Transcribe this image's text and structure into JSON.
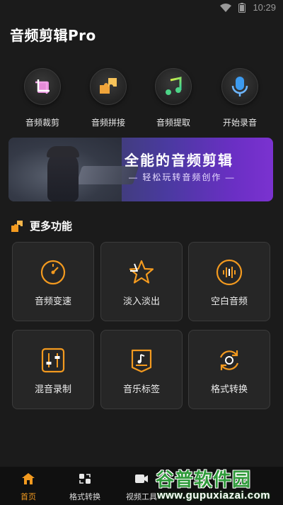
{
  "status": {
    "time": "10:29"
  },
  "app": {
    "title": "音频剪辑Pro"
  },
  "top_tools": [
    {
      "label": "音频裁剪",
      "icon": "crop-icon"
    },
    {
      "label": "音频拼接",
      "icon": "puzzle-icon"
    },
    {
      "label": "音频提取",
      "icon": "music-note-icon"
    },
    {
      "label": "开始录音",
      "icon": "microphone-icon"
    }
  ],
  "banner": {
    "title": "全能的音频剪辑",
    "subtitle": "— 轻松玩转音频创作 —"
  },
  "section": {
    "title": "更多功能"
  },
  "features": [
    {
      "label": "音频变速",
      "icon": "speedometer-icon"
    },
    {
      "label": "淡入淡出",
      "icon": "star-icon"
    },
    {
      "label": "空白音频",
      "icon": "waveform-icon"
    },
    {
      "label": "混音录制",
      "icon": "mixer-sliders-icon"
    },
    {
      "label": "音乐标签",
      "icon": "music-tag-icon"
    },
    {
      "label": "格式转换",
      "icon": "refresh-circle-icon"
    }
  ],
  "nav": [
    {
      "label": "首页",
      "active": true
    },
    {
      "label": "格式转换",
      "active": false
    },
    {
      "label": "视频工具",
      "active": false
    }
  ],
  "watermark": {
    "name": "谷普软件园",
    "url": "www.gupuxiazai.com"
  },
  "colors": {
    "accent": "#f39a1f",
    "background": "#1b1b1b",
    "card": "#262626"
  }
}
